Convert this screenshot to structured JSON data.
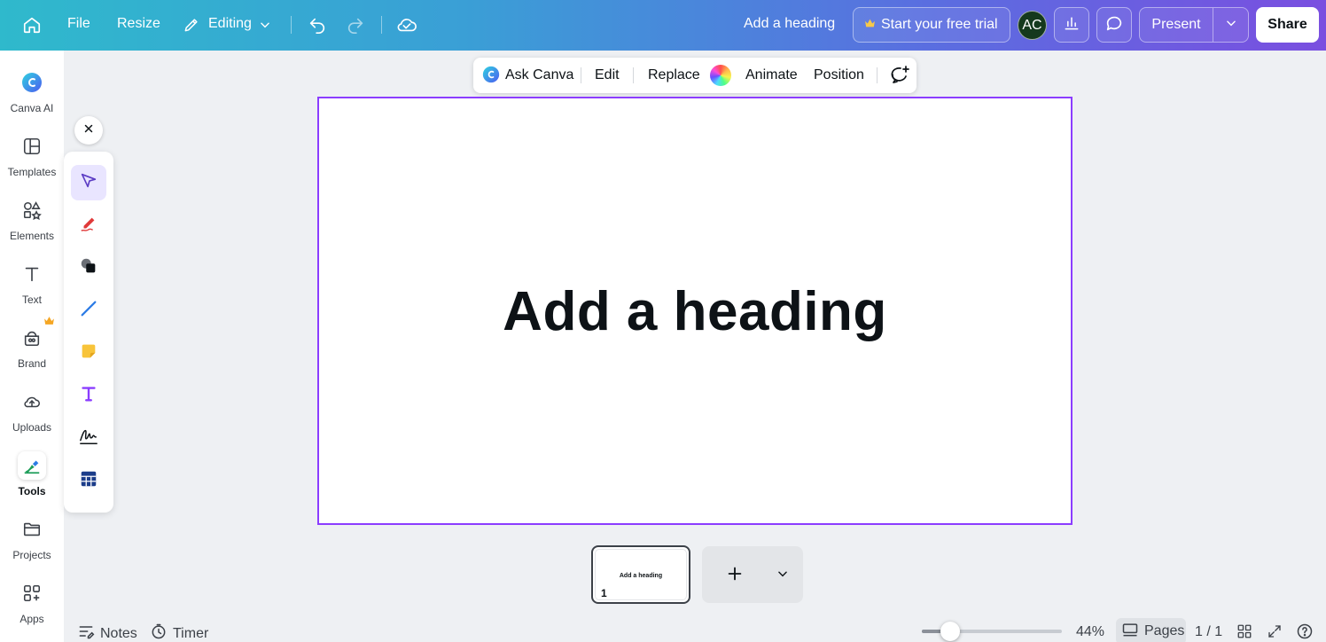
{
  "topbar": {
    "file_label": "File",
    "resize_label": "Resize",
    "editing_label": "Editing",
    "doc_title": "Add a heading",
    "trial_label": "Start your free trial",
    "avatar_initials": "AC",
    "present_label": "Present",
    "share_label": "Share",
    "icons": [
      "home-icon",
      "pencil-icon",
      "chevron-down-icon",
      "undo-icon",
      "redo-icon",
      "cloud-check-icon",
      "crown-icon",
      "chart-icon",
      "comment-icon"
    ]
  },
  "sidebar": {
    "items": [
      {
        "label": "Canva AI",
        "icon": "canva-ai-icon"
      },
      {
        "label": "Templates",
        "icon": "templates-icon"
      },
      {
        "label": "Elements",
        "icon": "elements-icon"
      },
      {
        "label": "Text",
        "icon": "text-icon"
      },
      {
        "label": "Brand",
        "icon": "brand-icon"
      },
      {
        "label": "Uploads",
        "icon": "upload-icon"
      },
      {
        "label": "Tools",
        "icon": "tools-icon"
      },
      {
        "label": "Projects",
        "icon": "folder-icon"
      },
      {
        "label": "Apps",
        "icon": "apps-icon"
      }
    ]
  },
  "tools_panel": {
    "tools": [
      "select-icon",
      "draw-icon",
      "shapes-icon",
      "line-icon",
      "sticky-note-icon",
      "text-tool-icon",
      "signature-icon",
      "table-icon"
    ]
  },
  "context_toolbar": {
    "ask_canva_label": "Ask Canva",
    "edit_label": "Edit",
    "replace_label": "Replace",
    "animate_label": "Animate",
    "position_label": "Position"
  },
  "canvas": {
    "heading": "Add a heading"
  },
  "page_strip": {
    "thumb_text": "Add a heading",
    "page_number": "1"
  },
  "bottombar": {
    "notes_label": "Notes",
    "timer_label": "Timer",
    "zoom_value": 44,
    "zoom_label": "44%",
    "pages_label": "Pages",
    "page_count": "1 / 1"
  },
  "colors": {
    "accent": "#8b3dff",
    "avatar_bg": "#15391d",
    "gradient_start": "#2fb9cc",
    "gradient_end": "#7a4fe0"
  }
}
